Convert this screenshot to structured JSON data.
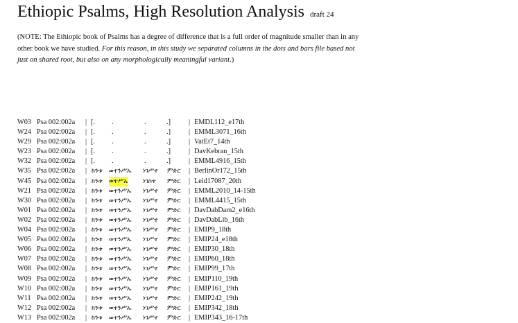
{
  "header": {
    "title": "Ethiopic Psalms, High Resolution Analysis",
    "draft": "draft 24"
  },
  "note": {
    "part1": "(NOTE: The Ethiopic book of Psalms has a degree of difference that is a full order of magnitude smaller than in any other book we have studied. ",
    "part2": "For this reason, in this study we separated columns in the dots and bars file based not just on shared root, but also on any morphologically meaningful variant.",
    "part3": ")"
  },
  "separator": "|",
  "empty_marks": {
    "open": "[.",
    "dot": ".",
    "close": ".]"
  },
  "rows": [
    {
      "siglum": "W03",
      "ref": "Psa 002:002a",
      "empty": true,
      "ms": "EMDL112_e17th"
    },
    {
      "siglum": "W24",
      "ref": "Psa 002:002a",
      "empty": true,
      "ms": "EMML3071_16th"
    },
    {
      "siglum": "W29",
      "ref": "Psa 002:002a",
      "empty": true,
      "ms": "VatEt7_14th"
    },
    {
      "siglum": "W23",
      "ref": "Psa 002:002a",
      "empty": true,
      "ms": "DavKebran_15th"
    },
    {
      "siglum": "W32",
      "ref": "Psa 002:002a",
      "empty": true,
      "ms": "EMML4916_15th"
    },
    {
      "siglum": "W35",
      "ref": "Psa 002:002a",
      "empty": false,
      "w1": "ከንቱ",
      "w2": "ወተንሥኡ",
      "w3": "ነገሥተ",
      "w4": "ምድር",
      "ms": "BerlinOr172_15th"
    },
    {
      "siglum": "W45",
      "ref": "Psa 002:002a",
      "empty": false,
      "w1": "ከንቱ",
      "w2": "ወተሥኡ",
      "w3": "ነገስተ",
      "w4": "ምድር",
      "ms": "Leid17087_20th",
      "hl": true
    },
    {
      "siglum": "W21",
      "ref": "Psa 002:002a",
      "empty": false,
      "w1": "ከንቱ",
      "w2": "ወተንሥኡ",
      "w3": "ነገሥተ",
      "w4": "ምድር",
      "ms": "EMML2010_14-15th"
    },
    {
      "siglum": "W30",
      "ref": "Psa 002:002a",
      "empty": false,
      "w1": "ከንቱ",
      "w2": "ወተንሥኡ",
      "w3": "ነገሥተ",
      "w4": "ምድር",
      "ms": "EMML4415_15th"
    },
    {
      "siglum": "W01",
      "ref": "Psa 002:002a",
      "empty": false,
      "w1": "ከንቱ",
      "w2": "ወተንሥኡ",
      "w3": "ነገሥተ",
      "w4": "ምድር",
      "ms": "DavDabDam2_e16th"
    },
    {
      "siglum": "W02",
      "ref": "Psa 002:002a",
      "empty": false,
      "w1": "ከንቱ",
      "w2": "ወተንሥኡ",
      "w3": "ነገሥተ",
      "w4": "ምድር",
      "ms": "DavDabLib_16th"
    },
    {
      "siglum": "W04",
      "ref": "Psa 002:002a",
      "empty": false,
      "w1": "ከንቱ",
      "w2": "ወተንሥኡ",
      "w3": "ነገሥተ",
      "w4": "ምድር",
      "ms": "EMIP9_18th"
    },
    {
      "siglum": "W05",
      "ref": "Psa 002:002a",
      "empty": false,
      "w1": "ከንቱ",
      "w2": "ወተንሥኡ",
      "w3": "ነገሥተ",
      "w4": "ምድር",
      "ms": "EMIP24_e18th"
    },
    {
      "siglum": "W06",
      "ref": "Psa 002:002a",
      "empty": false,
      "w1": "ከንቱ",
      "w2": "ወተንሥኡ",
      "w3": "ነገሥተ",
      "w4": "ምድር",
      "ms": "EMIP30_18th"
    },
    {
      "siglum": "W07",
      "ref": "Psa 002:002a",
      "empty": false,
      "w1": "ከንቱ",
      "w2": "ወተንሥኡ",
      "w3": "ነገሥተ",
      "w4": "ምድር",
      "ms": "EMIP60_18th"
    },
    {
      "siglum": "W08",
      "ref": "Psa 002:002a",
      "empty": false,
      "w1": "ከንቱ",
      "w2": "ወተንሥኡ",
      "w3": "ነገሥተ",
      "w4": "ምድር",
      "ms": "EMIP99_17th"
    },
    {
      "siglum": "W09",
      "ref": "Psa 002:002a",
      "empty": false,
      "w1": "ከንቱ",
      "w2": "ወተንሥኡ",
      "w3": "ነገሥተ",
      "w4": "ምድር",
      "ms": "EMIP110_19th"
    },
    {
      "siglum": "W10",
      "ref": "Psa 002:002a",
      "empty": false,
      "w1": "ከንቱ",
      "w2": "ወተንሥኡ",
      "w3": "ነገሥተ",
      "w4": "ምድር",
      "ms": "EMIP161_19th"
    },
    {
      "siglum": "W11",
      "ref": "Psa 002:002a",
      "empty": false,
      "w1": "ከንቱ",
      "w2": "ወተንሥኡ",
      "w3": "ነገሥተ",
      "w4": "ምድር",
      "ms": "EMIP242_19th"
    },
    {
      "siglum": "W12",
      "ref": "Psa 002:002a",
      "empty": false,
      "w1": "ከንቱ",
      "w2": "ወተንሥኡ",
      "w3": "ነገሥተ",
      "w4": "ምድር",
      "ms": "EMIP342_18th"
    },
    {
      "siglum": "W13",
      "ref": "Psa 002:002a",
      "empty": false,
      "w1": "ከንቱ",
      "w2": "ወተንሥኡ",
      "w3": "ነገሥተ",
      "w4": "ምድር",
      "ms": "EMIP343_16-17th"
    }
  ]
}
